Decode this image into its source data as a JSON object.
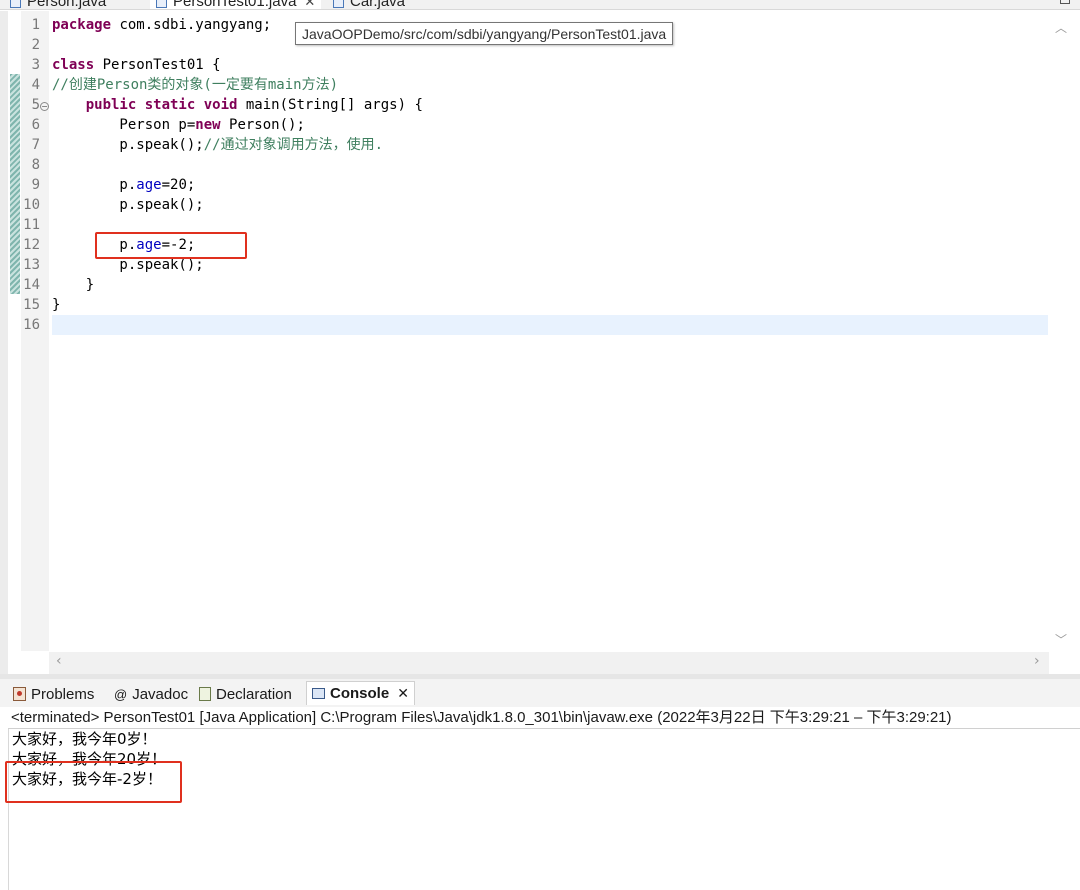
{
  "editor_tabs": [
    {
      "label": "Person.java",
      "active": false
    },
    {
      "label": "PersonTest01.java",
      "active": true
    },
    {
      "label": "Car.java",
      "active": false
    }
  ],
  "tooltip": "JavaOOPDemo/src/com/sdbi/yangyang/PersonTest01.java",
  "line_numbers": [
    "1",
    "2",
    "3",
    "4",
    "5",
    "6",
    "7",
    "8",
    "9",
    "10",
    "11",
    "12",
    "13",
    "14",
    "15",
    "16"
  ],
  "code": {
    "l1_kw": "package",
    "l1_rest": " com.sdbi.yangyang;",
    "l3_kw": "class",
    "l3_rest": " PersonTest01 {",
    "l4_comment": "//创建Person类的对象(一定要有main方法)",
    "l5_indent": "    ",
    "l5_kw": "public static void",
    "l5_rest": " main(String[] args) {",
    "l6_pre": "        Person p=",
    "l6_kw": "new",
    "l6_post": " Person();",
    "l7_code": "        p.speak();",
    "l7_comment": "//通过对象调用方法，使用.",
    "l9_pre": "        p.",
    "l9_field": "age",
    "l9_post": "=20;",
    "l10": "        p.speak();",
    "l12_pre": "        p.",
    "l12_field": "age",
    "l12_post": "=-2;",
    "l13": "        p.speak();",
    "l14": "    }",
    "l15": "}"
  },
  "panel_tabs": {
    "problems": "Problems",
    "javadoc": "Javadoc",
    "declaration": "Declaration",
    "console": "Console"
  },
  "console": {
    "status": "<terminated> PersonTest01 [Java Application] C:\\Program Files\\Java\\jdk1.8.0_301\\bin\\javaw.exe  (2022年3月22日 下午3:29:21 – 下午3:29:21)",
    "output": [
      "大家好，我今年0岁！",
      "大家好，我今年20岁！",
      "大家好，我今年-2岁！"
    ]
  },
  "icons": {
    "file_tab": "java-file-icon",
    "fold": "fold-collapse-icon",
    "javadoc": "at-sign-icon"
  },
  "colors": {
    "keyword": "#7f0055",
    "comment": "#3f7f5f",
    "field": "#0000c0",
    "highlight_box": "#e0301e",
    "current_line": "#e8f2fe"
  }
}
